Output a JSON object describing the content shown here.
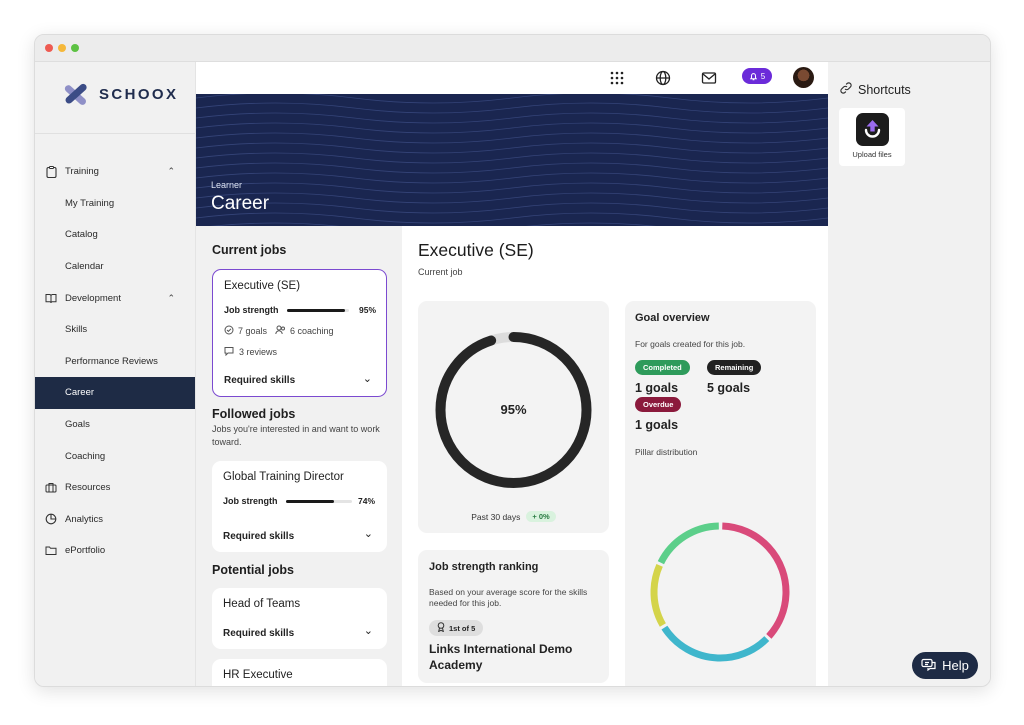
{
  "brand": {
    "name": "SCHOOX"
  },
  "sidebar": {
    "items": [
      {
        "label": "Training",
        "expandable": true
      },
      {
        "label": "My Training"
      },
      {
        "label": "Catalog"
      },
      {
        "label": "Calendar"
      },
      {
        "label": "Development",
        "expandable": true
      },
      {
        "label": "Skills"
      },
      {
        "label": "Performance Reviews"
      },
      {
        "label": "Career",
        "active": true
      },
      {
        "label": "Goals"
      },
      {
        "label": "Coaching"
      },
      {
        "label": "Resources"
      },
      {
        "label": "Analytics"
      },
      {
        "label": "ePortfolio"
      }
    ]
  },
  "topbar": {
    "notification_count": "5"
  },
  "banner": {
    "subtitle": "Learner",
    "title": "Career"
  },
  "current_jobs": {
    "heading": "Current jobs",
    "job": {
      "title": "Executive (SE)",
      "strength_label": "Job strength",
      "strength_pct": "95%",
      "strength_value": 0.95,
      "goals": "7 goals",
      "coaching": "6 coaching",
      "reviews": "3 reviews",
      "skills_label": "Required skills"
    }
  },
  "followed_jobs": {
    "heading": "Followed jobs",
    "description": "Jobs you're interested in and want to work toward.",
    "job": {
      "title": "Global Training Director",
      "strength_label": "Job strength",
      "strength_pct": "74%",
      "strength_value": 0.74,
      "skills_label": "Required skills"
    }
  },
  "potential_jobs": {
    "heading": "Potential jobs",
    "jobs": [
      {
        "title": "Head of Teams",
        "skills_label": "Required skills"
      },
      {
        "title": "HR Executive"
      }
    ]
  },
  "detail": {
    "title": "Executive (SE)",
    "subtitle": "Current job",
    "strength": {
      "value_label": "95%",
      "value": 0.95,
      "period": "Past 30 days",
      "change": "+ 0%"
    },
    "ranking": {
      "title": "Job strength ranking",
      "description": "Based on your average score for the skills needed for this job.",
      "rank": "1st of 5",
      "academy": "Links International Demo Academy"
    },
    "goals": {
      "title": "Goal overview",
      "description": "For goals created for this job.",
      "completed_label": "Completed",
      "completed_value": "1 goals",
      "remaining_label": "Remaining",
      "remaining_value": "5 goals",
      "overdue_label": "Overdue",
      "overdue_value": "1 goals",
      "pillar_label": "Pillar distribution"
    }
  },
  "shortcuts": {
    "title": "Shortcuts",
    "upload_label": "Upload files"
  },
  "help": {
    "label": "Help"
  },
  "colors": {
    "accent": "#6b2bd9",
    "nav_active": "#1e2b45",
    "completed": "#2e9b5b",
    "remaining": "#222222",
    "overdue": "#8b1a3c"
  }
}
